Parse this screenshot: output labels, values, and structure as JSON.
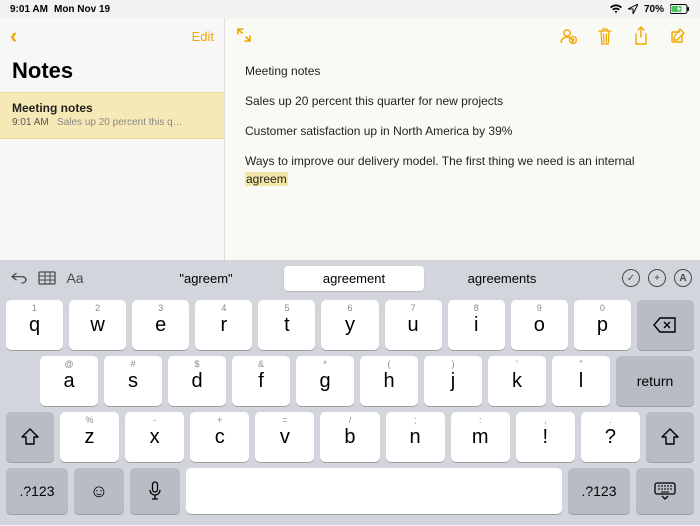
{
  "status": {
    "time": "9:01 AM",
    "date": "Mon Nov 19",
    "battery": "70%"
  },
  "sidebar": {
    "edit_label": "Edit",
    "title": "Notes",
    "items": [
      {
        "title": "Meeting notes",
        "time": "9:01 AM",
        "preview": "Sales up 20 percent this q…"
      }
    ]
  },
  "note": {
    "title": "Meeting notes",
    "p1": "Sales up 20 percent this quarter for new projects",
    "p2": "Customer satisfaction up in North America by 39%",
    "p3a": "Ways to improve our delivery model. The first thing we need is an internal ",
    "p3b": "agreem"
  },
  "suggestions": {
    "s0": "\"agreem\"",
    "s1": "agreement",
    "s2": "agreements"
  },
  "keyboard": {
    "aa": "Aa",
    "row1": [
      {
        "main": "q",
        "alt": "1"
      },
      {
        "main": "w",
        "alt": "2"
      },
      {
        "main": "e",
        "alt": "3"
      },
      {
        "main": "r",
        "alt": "4"
      },
      {
        "main": "t",
        "alt": "5"
      },
      {
        "main": "y",
        "alt": "6"
      },
      {
        "main": "u",
        "alt": "7"
      },
      {
        "main": "i",
        "alt": "8"
      },
      {
        "main": "o",
        "alt": "9"
      },
      {
        "main": "p",
        "alt": "0"
      }
    ],
    "row2": [
      {
        "main": "a",
        "alt": "@"
      },
      {
        "main": "s",
        "alt": "#"
      },
      {
        "main": "d",
        "alt": "$"
      },
      {
        "main": "f",
        "alt": "&"
      },
      {
        "main": "g",
        "alt": "*"
      },
      {
        "main": "h",
        "alt": "("
      },
      {
        "main": "j",
        "alt": ")"
      },
      {
        "main": "k",
        "alt": "'"
      },
      {
        "main": "l",
        "alt": "\""
      }
    ],
    "row3": [
      {
        "main": "z",
        "alt": "%"
      },
      {
        "main": "x",
        "alt": "-"
      },
      {
        "main": "c",
        "alt": "+"
      },
      {
        "main": "v",
        "alt": "="
      },
      {
        "main": "b",
        "alt": "/"
      },
      {
        "main": "n",
        "alt": ";"
      },
      {
        "main": "m",
        "alt": ":"
      },
      {
        "main": "!",
        "alt": ","
      },
      {
        "main": "?",
        "alt": "."
      }
    ],
    "numkey": ".?123",
    "return": "return"
  }
}
